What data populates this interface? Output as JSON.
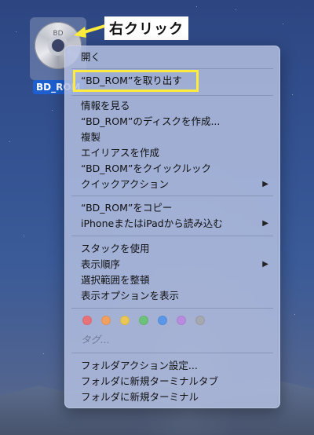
{
  "desktop": {
    "disc_icon_label": "BD_ROM",
    "disc_text": "BD"
  },
  "annotation": {
    "label": "右クリック"
  },
  "menu": {
    "open": "開く",
    "eject": "“BD_ROM”を取り出す",
    "get_info": "情報を見る",
    "burn": "“BD_ROM”のディスクを作成...",
    "duplicate": "複製",
    "make_alias": "エイリアスを作成",
    "quick_look": "“BD_ROM”をクイックルック",
    "quick_actions": "クイックアクション",
    "copy": "“BD_ROM”をコピー",
    "import_iphone": "iPhoneまたはiPadから読み込む",
    "use_stacks": "スタックを使用",
    "sort_by": "表示順序",
    "clean_up_selection": "選択範囲を整頓",
    "show_view_options": "表示オプションを表示",
    "tags_label": "タグ...",
    "folder_actions_setup": "フォルダアクション設定...",
    "new_terminal_tab": "フォルダに新規ターミナルタブ",
    "new_terminal": "フォルダに新規ターミナル",
    "submenu_arrow": "▶"
  },
  "tag_colors": [
    {
      "name": "red",
      "color": "#e8717a"
    },
    {
      "name": "orange",
      "color": "#f0a060"
    },
    {
      "name": "yellow",
      "color": "#eac654"
    },
    {
      "name": "green",
      "color": "#6cc27a"
    },
    {
      "name": "blue",
      "color": "#5b97e8"
    },
    {
      "name": "purple",
      "color": "#b98be0"
    },
    {
      "name": "gray",
      "color": "#a5a8b0"
    }
  ],
  "colors": {
    "highlight_border": "#ffeb3b",
    "selection_label_bg": "#1d5fd1"
  }
}
